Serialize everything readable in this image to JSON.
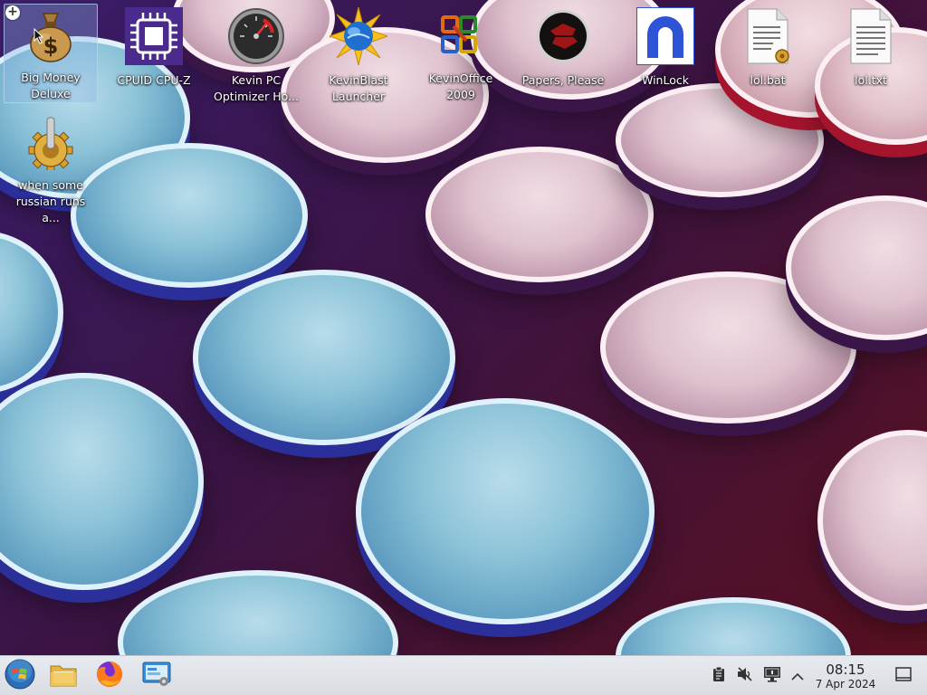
{
  "desktop": {
    "icons": [
      {
        "label": "Big Money Deluxe",
        "icon": "money-bag-icon"
      },
      {
        "label": "CPUID CPU-Z",
        "icon": "cpu-chip-icon"
      },
      {
        "label": "Kevin PC Optimizer Ho...",
        "icon": "speedometer-icon"
      },
      {
        "label": "KevinBlast Launcher",
        "icon": "globe-burst-icon"
      },
      {
        "label": "KevinOffice 2009",
        "icon": "office-logo-icon"
      },
      {
        "label": "Papers, Please",
        "icon": "papers-please-icon"
      },
      {
        "label": "WinLock",
        "icon": "winlock-icon"
      },
      {
        "label": "lol.bat",
        "icon": "batch-file-icon"
      },
      {
        "label": "lol.txt",
        "icon": "text-file-icon"
      },
      {
        "label": "when some russian runs a...",
        "icon": "gear-icon"
      }
    ]
  },
  "taskbar": {
    "start": {
      "icon": "start-orb-icon"
    },
    "pinned": [
      {
        "icon": "file-manager-icon",
        "name": "File Manager"
      },
      {
        "icon": "firefox-icon",
        "name": "Firefox"
      },
      {
        "icon": "system-settings-icon",
        "name": "System Settings"
      }
    ],
    "tray": [
      {
        "icon": "clipboard-icon"
      },
      {
        "icon": "volume-muted-icon"
      },
      {
        "icon": "display-icon"
      },
      {
        "icon": "chevron-up-icon"
      }
    ],
    "clock": {
      "time": "08:15",
      "date": "7 Apr 2024"
    },
    "show_desktop": {
      "icon": "show-desktop-icon"
    }
  }
}
